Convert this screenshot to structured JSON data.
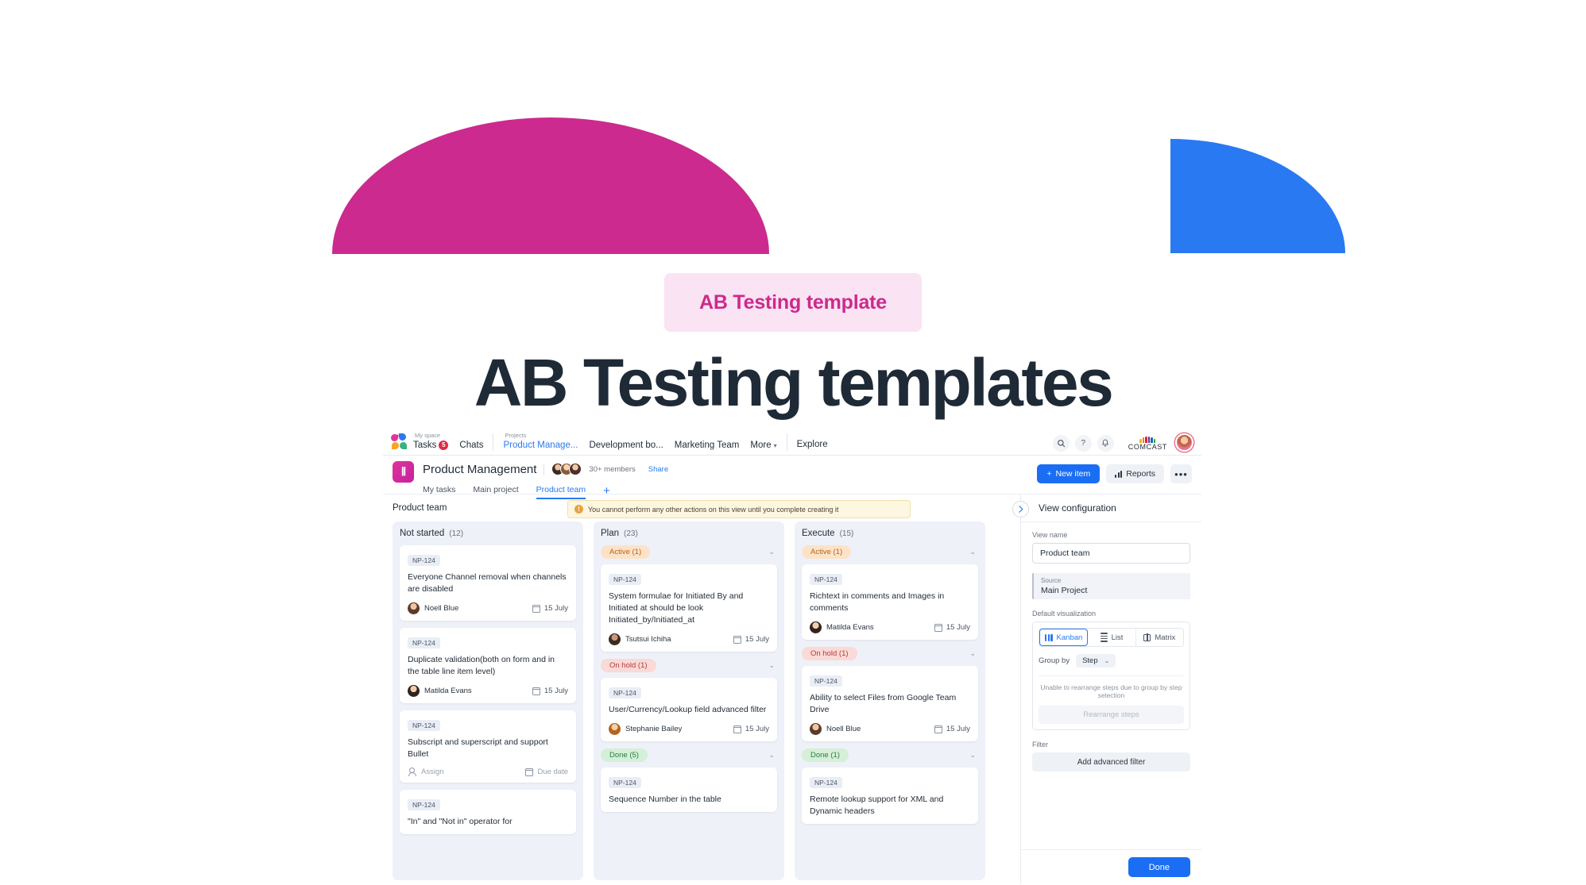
{
  "hero": {
    "badge": "AB Testing template",
    "title": "AB Testing templates",
    "pink_shape_color": "#cc2a8e",
    "blue_shape_color": "#2979f2",
    "badge_bg": "#fae3f2",
    "badge_text_color": "#cc2a8e",
    "title_color": "#1f2a37"
  },
  "topnav": {
    "my_space_caption": "My space",
    "tasks_label": "Tasks",
    "tasks_badge": "5",
    "chats_label": "Chats",
    "projects_caption": "Projects",
    "projects": [
      {
        "label": "Product Manage...",
        "active": true
      },
      {
        "label": "Development bo...",
        "active": false
      },
      {
        "label": "Marketing Team",
        "active": false
      },
      {
        "label": "More",
        "active": false
      }
    ],
    "explore_label": "Explore",
    "search_icon": "search-icon",
    "help_icon": "question-mark-icon",
    "bell_icon": "notification-bell-icon",
    "brand_name": "COMCAST",
    "avatar": "user-avatar"
  },
  "project_header": {
    "title": "Product Management",
    "members_text": "30+ members",
    "share_label": "Share",
    "tabs": [
      {
        "label": "My tasks",
        "active": false
      },
      {
        "label": "Main project",
        "active": false
      },
      {
        "label": "Product team",
        "active": true
      }
    ],
    "add_tab_label": "+",
    "new_item_label": "New item",
    "reports_label": "Reports",
    "more_label": "•••"
  },
  "board": {
    "view_title": "Product team",
    "warning": "You cannot perform any other actions on this view until you complete creating it",
    "columns": [
      {
        "name": "Not started",
        "count": "(12)",
        "groups": [],
        "cards": [
          {
            "key": "NP-124",
            "title": "Everyone Channel removal when channels are disabled",
            "assignee": "Noell Blue",
            "avatar_class": "av-noell",
            "due": "15 July",
            "unassigned": false
          },
          {
            "key": "NP-124",
            "title": "Duplicate validation(both on form and in the table line item level)",
            "assignee": "Matilda Evans",
            "avatar_class": "av-matilda",
            "due": "15 July",
            "unassigned": false
          },
          {
            "key": "NP-124",
            "title": "Subscript and superscript  and support Bullet",
            "assignee": "Assign",
            "avatar_class": "",
            "due": "Due date",
            "unassigned": true
          },
          {
            "key": "NP-124",
            "title": "\"In\" and \"Not in\" operator for",
            "assignee": "",
            "avatar_class": "",
            "due": "",
            "unassigned": false
          }
        ]
      },
      {
        "name": "Plan",
        "count": "(23)",
        "groups": [
          {
            "chip": "Active (1)",
            "style": "chip-active"
          },
          {
            "chip": "On hold (1)",
            "style": "chip-hold"
          },
          {
            "chip": "Done (5)",
            "style": "chip-done"
          }
        ],
        "cards": [
          {
            "key": "NP-124",
            "title": "System formulae for Initiated By and Initiated at should be look Initiated_by/Initiated_at",
            "assignee": "Tsutsui Ichiha",
            "avatar_class": "av-tsutsui",
            "due": "15 July",
            "unassigned": false
          },
          {
            "key": "NP-124",
            "title": "User/Currency/Lookup field advanced filter",
            "assignee": "Stephanie Bailey",
            "avatar_class": "av-steph",
            "due": "15 July",
            "unassigned": false
          },
          {
            "key": "NP-124",
            "title": "Sequence Number in the table",
            "assignee": "",
            "avatar_class": "",
            "due": "",
            "unassigned": false
          }
        ]
      },
      {
        "name": "Execute",
        "count": "(15)",
        "groups": [
          {
            "chip": "Active (1)",
            "style": "chip-active"
          },
          {
            "chip": "On hold (1)",
            "style": "chip-hold"
          },
          {
            "chip": "Done (1)",
            "style": "chip-done"
          }
        ],
        "cards": [
          {
            "key": "NP-124",
            "title": "Richtext in comments and Images in comments",
            "assignee": "Matilda Evans",
            "avatar_class": "av-matilda",
            "due": "15 July",
            "unassigned": false
          },
          {
            "key": "NP-124",
            "title": "Ability to select Files from Google Team Drive",
            "assignee": "Noell Blue",
            "avatar_class": "av-noell",
            "due": "15 July",
            "unassigned": false
          },
          {
            "key": "NP-124",
            "title": "Remote lookup support for XML and Dynamic headers",
            "assignee": "",
            "avatar_class": "",
            "due": "",
            "unassigned": false
          }
        ]
      }
    ]
  },
  "side_panel": {
    "title": "View configuration",
    "view_name_label": "View name",
    "view_name_value": "Product team",
    "source_label": "Source",
    "source_value": "Main Project",
    "default_visualization_label": "Default visualization",
    "viz_options": [
      {
        "label": "Kanban",
        "icon": "kanban-icon",
        "active": true
      },
      {
        "label": "List",
        "icon": "list-icon",
        "active": false
      },
      {
        "label": "Matrix",
        "icon": "matrix-icon",
        "active": false
      }
    ],
    "group_by_label": "Group by",
    "group_by_value": "Step",
    "rearrange_note": "Unable to rearrange steps due to group by step selection",
    "rearrange_button": "Rearrange steps",
    "filter_label": "Filter",
    "filter_button": "Add advanced filter",
    "done_label": "Done",
    "accent_color": "#1b6ef3"
  }
}
